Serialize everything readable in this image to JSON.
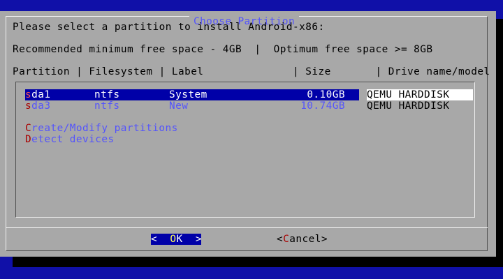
{
  "window": {
    "title": "Choose Partition"
  },
  "prompt": "Please select a partition to install Android-x86:",
  "space_note": "Recommended minimum free space - 4GB  |  Optimum free space >= 8GB",
  "columns": {
    "header_line": "Partition | Filesystem | Label              | Size       | Drive name/model"
  },
  "partitions": [
    {
      "hotkey": "s",
      "rest": "da1",
      "filesystem": "ntfs",
      "label": "System",
      "size": "0.10GB",
      "drive": "QEMU HARDDISK"
    },
    {
      "hotkey": "s",
      "rest": "da3",
      "filesystem": "ntfs",
      "label": "New",
      "size": "10.74GB",
      "drive": "QEMU HARDDISK"
    }
  ],
  "actions": [
    {
      "hotkey": "C",
      "rest": "reate/Modify partitions"
    },
    {
      "hotkey": "D",
      "rest": "etect devices"
    }
  ],
  "buttons": {
    "ok": {
      "left": "<  ",
      "hotkey": "O",
      "rest": "K",
      "right": "  >"
    },
    "cancel": {
      "left": "<",
      "hotkey": "C",
      "rest": "ancel",
      "right": ">"
    }
  }
}
